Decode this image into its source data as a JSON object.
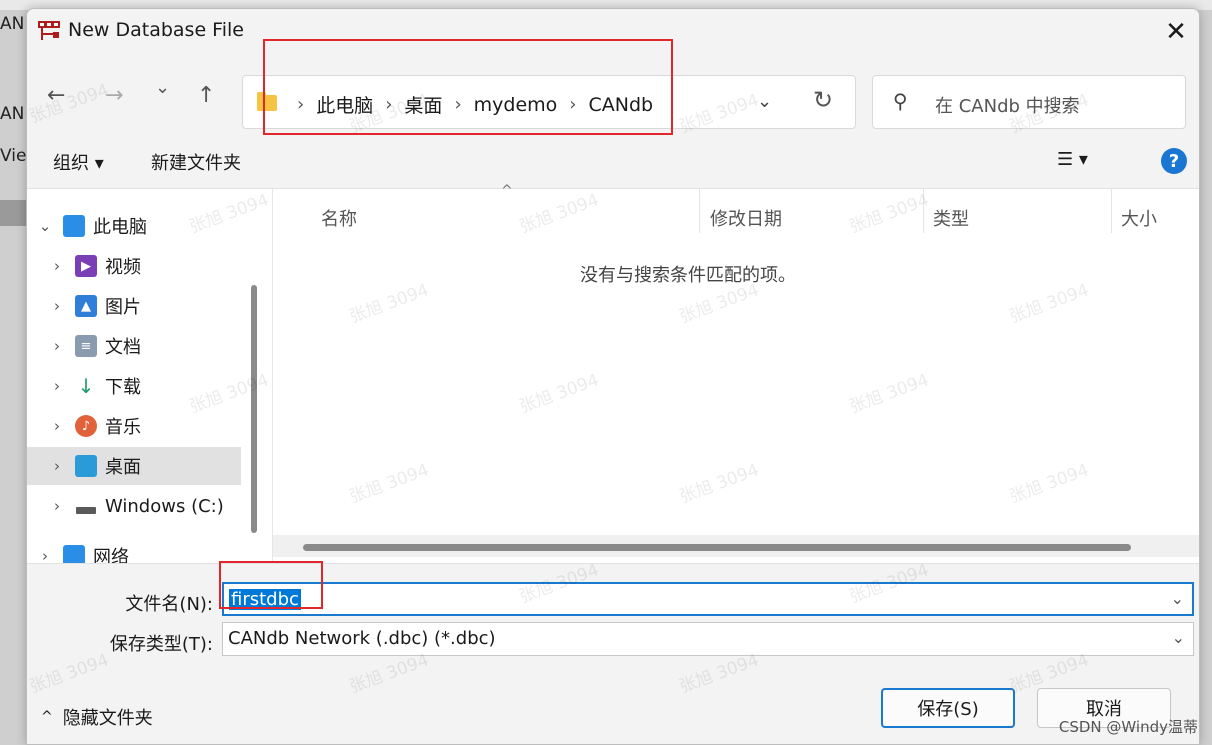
{
  "dialog": {
    "title": "New Database File",
    "close_glyph": "✕"
  },
  "nav": {
    "back_glyph": "←",
    "forward_glyph": "→",
    "recent_glyph": "⌄",
    "up_glyph": "↑",
    "refresh_glyph": "↻",
    "dropdown_glyph": "⌄",
    "breadcrumbs": [
      "此电脑",
      "桌面",
      "mydemo",
      "CANdb"
    ],
    "separator": "›"
  },
  "search": {
    "placeholder": "在 CANdb 中搜索",
    "icon": "search-icon"
  },
  "toolbar": {
    "organize_label": "组织 ▾",
    "new_folder_label": "新建文件夹",
    "view_glyph": "☰ ▾",
    "help_glyph": "?"
  },
  "sidebar": {
    "items": [
      {
        "label": "此电脑",
        "icon": "computer-icon",
        "chevron": "⌄",
        "color": "#2b8ee6"
      },
      {
        "label": "视频",
        "icon": "video-icon",
        "chevron": "›",
        "color": "#7a3fb5"
      },
      {
        "label": "图片",
        "icon": "picture-icon",
        "chevron": "›",
        "color": "#2f7ed8"
      },
      {
        "label": "文档",
        "icon": "document-icon",
        "chevron": "›",
        "color": "#8a9bb0"
      },
      {
        "label": "下载",
        "icon": "download-icon",
        "chevron": "›",
        "color": "#1f9e6e"
      },
      {
        "label": "音乐",
        "icon": "music-icon",
        "chevron": "›",
        "color": "#e0613a"
      },
      {
        "label": "桌面",
        "icon": "desktop-icon",
        "chevron": "›",
        "color": "#2b9ad8"
      },
      {
        "label": "Windows (C:)",
        "icon": "drive-icon",
        "chevron": "›",
        "color": "#5a5a5a"
      },
      {
        "label": "网络",
        "icon": "network-icon",
        "chevron": "›",
        "color": "#2b8ee6"
      }
    ],
    "selected": "桌面"
  },
  "list": {
    "columns": [
      "名称",
      "修改日期",
      "类型",
      "大小"
    ],
    "sort_caret": "^",
    "empty_message": "没有与搜索条件匹配的项。"
  },
  "form": {
    "filename_label": "文件名(N):",
    "filename_value": "firstdbc",
    "filetype_label": "保存类型(T):",
    "filetype_value": "CANdb Network (.dbc) (*.dbc)",
    "caret_glyph": "⌄"
  },
  "footer": {
    "hide_folders_label": "隐藏文件夹",
    "hide_glyph": "^",
    "save_label": "保存(S)",
    "cancel_label": "取消"
  },
  "background": {
    "snippets": [
      "AN",
      "AN",
      "Vie"
    ]
  },
  "overlay": {
    "watermark": "张旭 3094",
    "credit": "CSDN @Windy温蒂"
  },
  "colors": {
    "accent": "#1979cf",
    "highlight_box": "#e3262a",
    "selection": "#0078d7"
  }
}
